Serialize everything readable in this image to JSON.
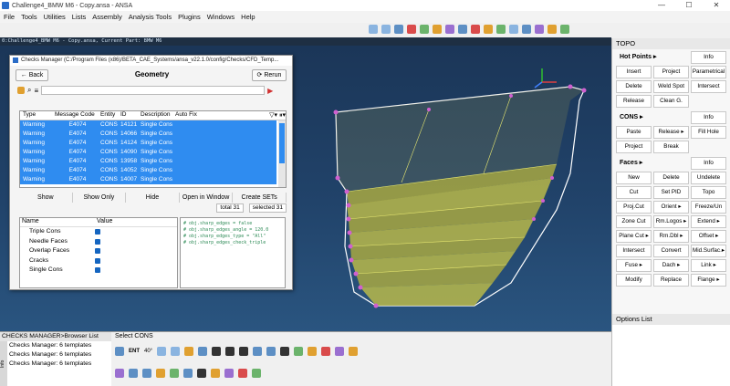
{
  "window": {
    "title": "Challenge4_BMW M6 - Copy.ansa - ANSA",
    "controls": [
      "—",
      "☐",
      "✕"
    ]
  },
  "menu": [
    "File",
    "Tools",
    "Utilities",
    "Lists",
    "Assembly",
    "Analysis Tools",
    "Plugins",
    "Windows",
    "Help"
  ],
  "status_line": "0:Challenge4_BMW M6 - Copy.ansa,  Current Part: BMW M6",
  "dialog": {
    "title": "Checks Manager (C:/Program Files (x86)/BETA_CAE_Systems/ansa_v22.1.0/config/Checks/CFD_Temp...",
    "heading": "Geometry",
    "back_label": "Back",
    "rerun_label": "Rerun",
    "columns": [
      "Type",
      "Message Code",
      "Entity",
      "ID",
      "Description",
      "Auto Fix"
    ],
    "rows": [
      [
        "Warning",
        "E4074",
        "CONS",
        "14121",
        "Single Cons"
      ],
      [
        "Warning",
        "E4074",
        "CONS",
        "14066",
        "Single Cons"
      ],
      [
        "Warning",
        "E4074",
        "CONS",
        "14124",
        "Single Cons"
      ],
      [
        "Warning",
        "E4074",
        "CONS",
        "14090",
        "Single Cons"
      ],
      [
        "Warning",
        "E4074",
        "CONS",
        "13958",
        "Single Cons"
      ],
      [
        "Warning",
        "E4074",
        "CONS",
        "14052",
        "Single Cons"
      ],
      [
        "Warning",
        "E4074",
        "CONS",
        "14007",
        "Single Cons"
      ]
    ],
    "actions": [
      "Show",
      "Show Only",
      "Hide",
      "Open in Window",
      "Create SETs"
    ],
    "total": "total 31",
    "selected": "selected 31",
    "settings_header": {
      "name": "Name",
      "value": "Value"
    },
    "settings": [
      "Triple Cons",
      "Needle Faces",
      "Overlap Faces",
      "Cracks",
      "Single Cons"
    ],
    "code_lines": [
      "# obj.sharp_edges = false",
      "# obj.sharp_edges_angle = 120.0",
      "# obj.sharp_edges_type = \"All\"",
      "# obj.sharp_edges_check_triple"
    ]
  },
  "topo": {
    "title": "TOPO",
    "sections": [
      {
        "label": "Hot Points ▸",
        "info": "Info",
        "buttons": [
          "Insert",
          "Project",
          "Parametrical",
          "Delete",
          "Weld Spot",
          "Intersect",
          "Release",
          "Clean G."
        ]
      },
      {
        "label": "CONS ▸",
        "info": "Info",
        "buttons": [
          "Paste",
          "Release ▸",
          "Fill Hole",
          "Project",
          "Break"
        ]
      },
      {
        "label": "Faces ▸",
        "info": "Info",
        "buttons": [
          "New",
          "Delete",
          "Undelete",
          "Cut",
          "Set PID",
          "Topo",
          "Proj.Cut",
          "Orient ▸",
          "Freeze/Un",
          "Zone Cut",
          "Rm.Logos ▸",
          "Extend ▸",
          "Plane Cut ▸",
          "Rm.Dbl ▸",
          "Offset ▸",
          "Intersect",
          "Convert",
          "Mid.Surfac.▸",
          "Fuse ▸",
          "Dach ▸",
          "Link ▸",
          "Modify",
          "Replace",
          "Flange ▸"
        ]
      }
    ]
  },
  "options_list": {
    "title": "Options List"
  },
  "browser": {
    "title": "CHECKS MANAGER>Browser List",
    "items": [
      "Checks Manager: 6 templates",
      "Checks Manager: 6 templates",
      "Checks Manager: 6 templates"
    ],
    "info_tab": "Info"
  },
  "bottom": {
    "title": "Select CONS",
    "angle": "40°",
    "ent": "ENT"
  },
  "colors": {
    "viewport_top": "#1b3658",
    "selection": "#2f8cf0",
    "mesh": "#c8c85a",
    "hotpoint": "#d060d0"
  }
}
